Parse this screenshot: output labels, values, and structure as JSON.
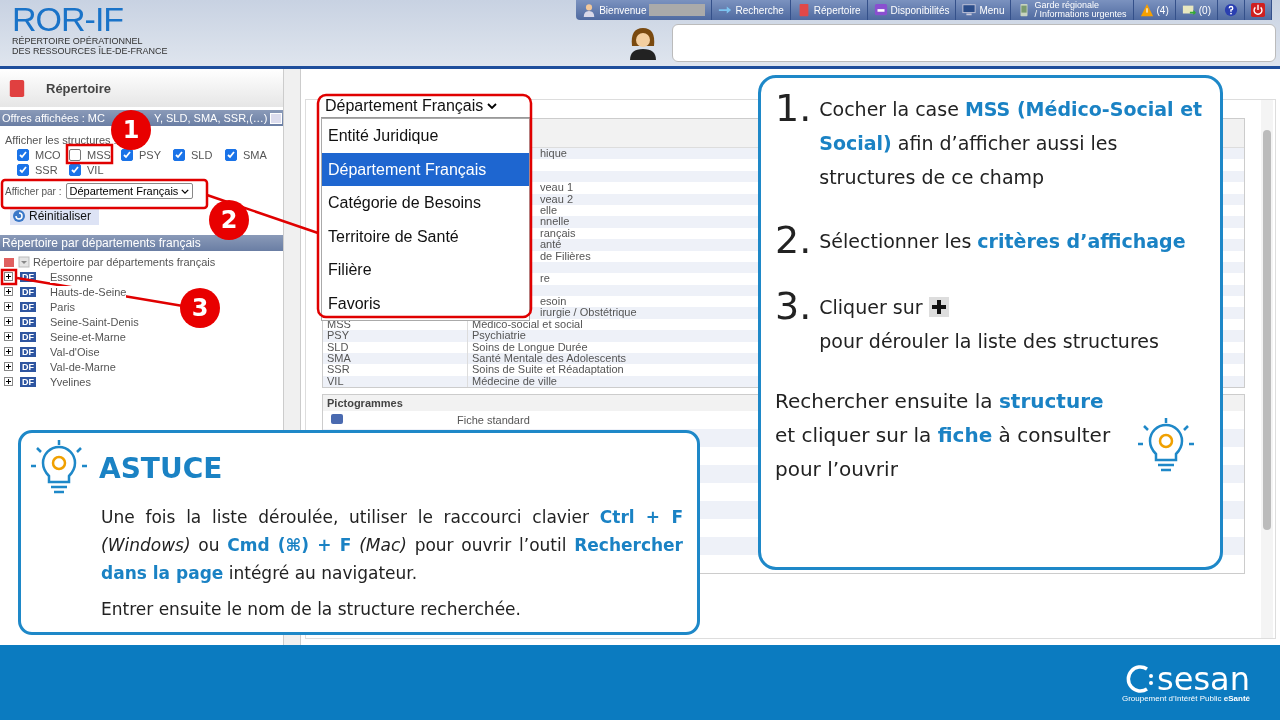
{
  "header": {
    "logo_title": "ROR-IF",
    "logo_lines": [
      "RÉPERTOIRE OPÉRATIONNEL",
      "DES RESSOURCES ÎLE-DE-FRANCE"
    ]
  },
  "nav": [
    {
      "kind": "user",
      "label": "Bienvenue"
    },
    {
      "kind": "search",
      "label": "Recherche"
    },
    {
      "kind": "directory",
      "label": "Répertoire"
    },
    {
      "kind": "beds",
      "label": "Disponibilités"
    },
    {
      "kind": "menu",
      "label": "Menu"
    },
    {
      "kind": "phone",
      "label": "Garde régionale\n/ Informations urgentes"
    },
    {
      "kind": "warning",
      "label": "(4)"
    },
    {
      "kind": "mail",
      "label": "(0)"
    },
    {
      "kind": "help"
    },
    {
      "kind": "power"
    }
  ],
  "sidebar": {
    "title": "Répertoire",
    "offers_parts": [
      "Offres affichées : MC",
      "Y, SLD, SMA, SSR,(…)"
    ],
    "structures_label": "Afficher les structures :",
    "structures": [
      {
        "label": "MCO",
        "checked": true
      },
      {
        "label": "MSS",
        "checked": false
      },
      {
        "label": "PSY",
        "checked": true
      },
      {
        "label": "SLD",
        "checked": true
      },
      {
        "label": "SMA",
        "checked": true
      },
      {
        "label": "SSR",
        "checked": true
      },
      {
        "label": "VIL",
        "checked": true
      }
    ],
    "display_by_label": "Afficher par :",
    "display_by_value": "Département Français",
    "reset": "Réinitialiser",
    "tree_header": "Répertoire par départements français",
    "tree": {
      "label": "Répertoire par départements français",
      "children": [
        {
          "label": "Essonne",
          "badge": "DF",
          "expanded": false
        },
        {
          "label": "Hauts-de-Seine",
          "badge": "DF",
          "expanded": false
        },
        {
          "label": "Paris",
          "badge": "DF",
          "expanded": false
        },
        {
          "label": "Seine-Saint-Denis",
          "badge": "DF",
          "expanded": false
        },
        {
          "label": "Seine-et-Marne",
          "badge": "DF",
          "expanded": false
        },
        {
          "label": "Val-d'Oise",
          "badge": "DF",
          "expanded": false
        },
        {
          "label": "Val-de-Marne",
          "badge": "DF",
          "expanded": false
        },
        {
          "label": "Yvelines",
          "badge": "DF",
          "expanded": false
        }
      ]
    }
  },
  "dropdown": {
    "value": "Département Français",
    "options": [
      {
        "label": "Entité Juridique",
        "selected": false
      },
      {
        "label": "Département Français",
        "selected": true
      },
      {
        "label": "Catégorie de Besoins",
        "selected": false
      },
      {
        "label": "Territoire de Santé",
        "selected": false
      },
      {
        "label": "Filière",
        "selected": false
      },
      {
        "label": "Favoris",
        "selected": false
      }
    ]
  },
  "legend_rows": [
    {
      "label": "hique"
    },
    {
      "label": ""
    },
    {
      "label": ""
    },
    {
      "label": "veau 1"
    },
    {
      "label": "veau 2"
    },
    {
      "label": "elle"
    },
    {
      "label": "nnelle"
    },
    {
      "label": "rançais"
    },
    {
      "label": "anté"
    },
    {
      "label": "de Filières"
    },
    {
      "label": ""
    },
    {
      "label": "re"
    },
    {
      "label": ""
    },
    {
      "label": "esoin"
    },
    {
      "label": "irurgie / Obstétrique"
    },
    {
      "code": "MSS",
      "label": "Médico-social et social"
    },
    {
      "code": "PSY",
      "label": "Psychiatrie"
    },
    {
      "code": "SLD",
      "label": "Soins de Longue Durée"
    },
    {
      "code": "SMA",
      "label": "Santé Mentale des Adolescents"
    },
    {
      "code": "SSR",
      "label": "Soins de Suite et Réadaptation"
    },
    {
      "code": "VIL",
      "label": "Médecine de ville"
    }
  ],
  "pictogrammes": {
    "title": "Pictogrammes",
    "rows": [
      {
        "label": "Fiche standard"
      }
    ]
  },
  "markers": [
    "1",
    "2",
    "3"
  ],
  "steps": [
    {
      "number": "1.",
      "text": "Cocher la case **MSS (Médico-Social et Social)** afin d’afficher aussi les structures de ce champ"
    },
    {
      "number": "2.",
      "text": "Sélectionner les **critères d’affichage**"
    },
    {
      "number": "3.",
      "text_before": "Cliquer sur",
      "text_after": "pour dérouler la liste des structures"
    }
  ],
  "tip": "Rechercher ensuite la **structure** et cliquer sur la **fiche** à consulter pour l’ouvrir",
  "astuce": {
    "title": "ASTUCE",
    "paragraphs": [
      "Une fois la liste déroulée, utiliser le raccourci clavier **Ctrl + F** *(Windows)* ou **Cmd (⌘) + F** *(Mac)* pour ouvrir l’outil **Rechercher dans la page** intégré au navigateur.",
      "Entrer ensuite le nom de la structure recherchée."
    ]
  },
  "footer": {
    "logo": "sesan",
    "tagline": "Groupement d’Intérêt Public **eSanté**"
  }
}
